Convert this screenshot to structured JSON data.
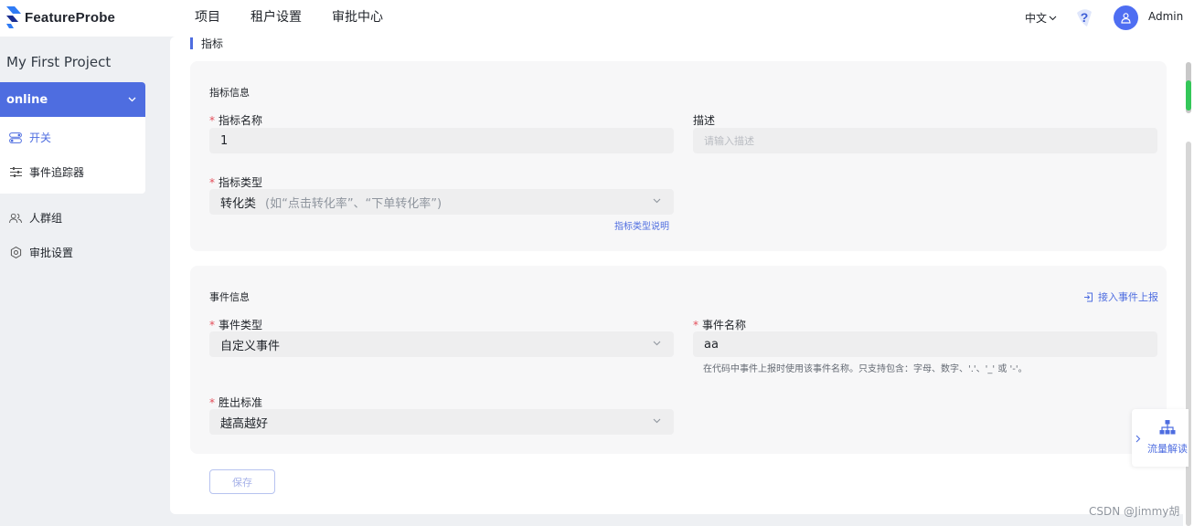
{
  "header": {
    "logo_text": "FeatureProbe",
    "nav": [
      "项目",
      "租户设置",
      "审批中心"
    ],
    "language": "中文",
    "user": "Admin"
  },
  "sidebar": {
    "project_name": "My First Project",
    "environment": "online",
    "env_items": [
      {
        "label": "开关",
        "icon": "toggle-icon",
        "active": true
      },
      {
        "label": "事件追踪器",
        "icon": "sliders-icon",
        "active": false
      }
    ],
    "items": [
      {
        "label": "人群组",
        "icon": "users-icon"
      },
      {
        "label": "审批设置",
        "icon": "gear-icon"
      }
    ]
  },
  "main": {
    "section_title": "指标",
    "metric_card": {
      "title": "指标信息",
      "name_label": "指标名称",
      "name_value": "1",
      "desc_label": "描述",
      "desc_placeholder": "请输入描述",
      "type_label": "指标类型",
      "type_value": "转化类",
      "type_hint": "(如“点击转化率”、“下单转化率”)",
      "type_help_link": "指标类型说明"
    },
    "event_card": {
      "title": "事件信息",
      "connect_link": "接入事件上报",
      "event_type_label": "事件类型",
      "event_type_value": "自定义事件",
      "event_name_label": "事件名称",
      "event_name_value": "aa",
      "event_name_help": "在代码中事件上报时使用该事件名称。只支持包含：字母、数字、'.'、'_' 或 '-'。",
      "win_label": "胜出标准",
      "win_value": "越高越好"
    },
    "save_label": "保存"
  },
  "flow_panel": {
    "label": "流量解读"
  },
  "watermark": "CSDN @Jimmy胡",
  "colors": {
    "accent": "#4e6de0",
    "required": "#e34d59",
    "scroll_green": "#34c759"
  }
}
